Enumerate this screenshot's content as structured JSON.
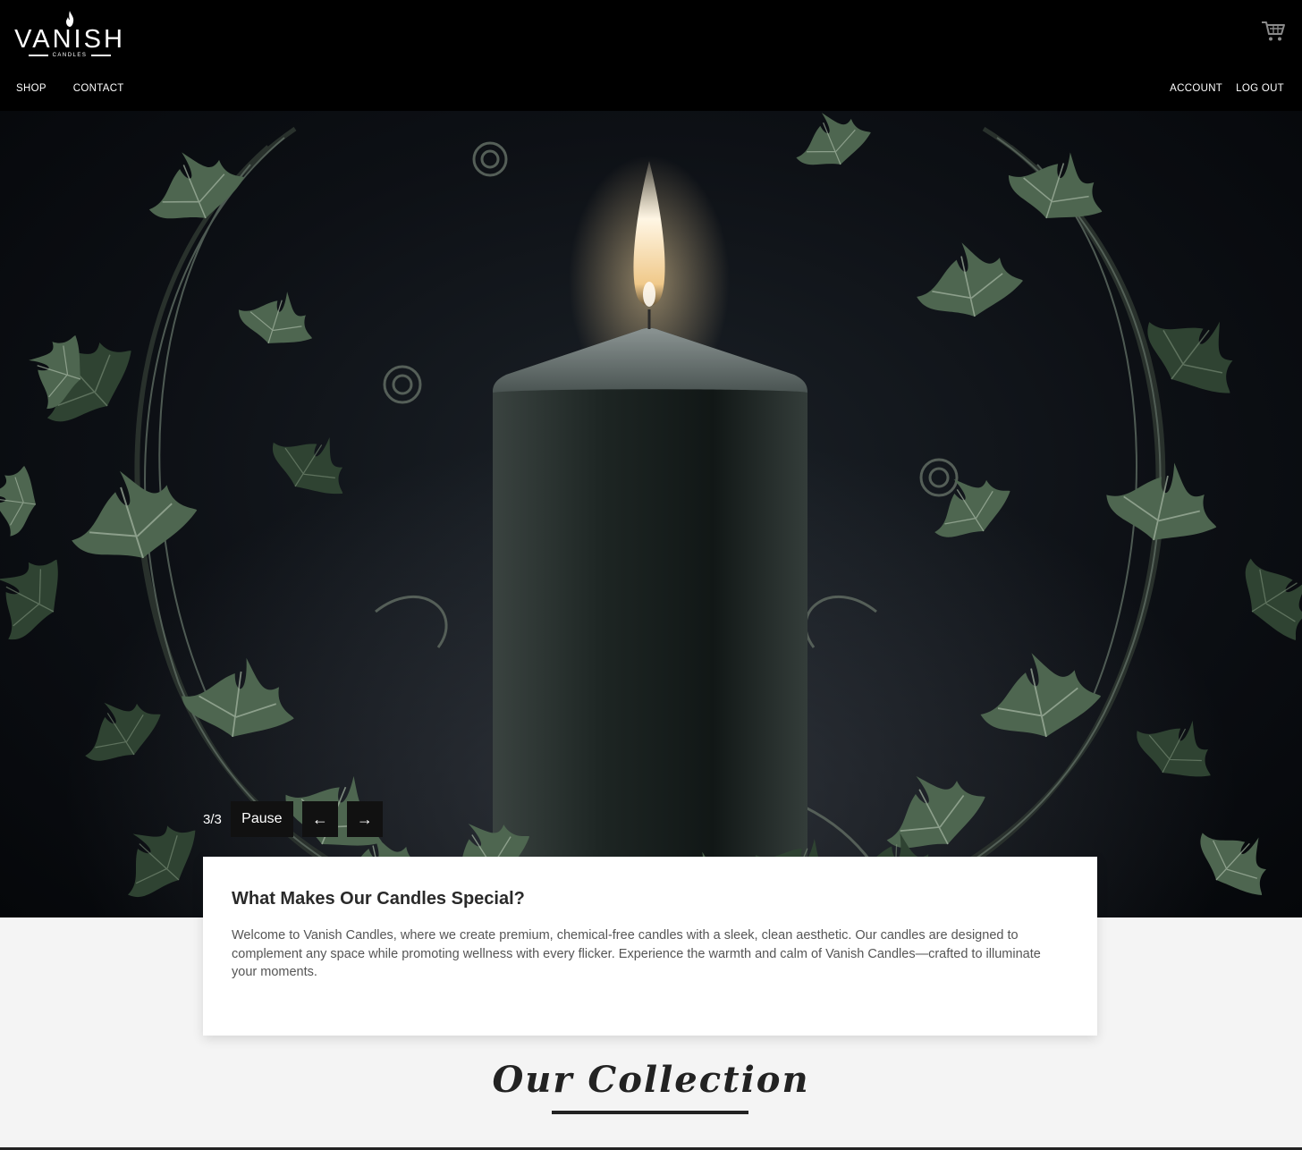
{
  "brand": {
    "name": "VANISH",
    "tagline": "CANDLES"
  },
  "nav": {
    "left": [
      "SHOP",
      "CONTACT"
    ],
    "right": [
      "ACCOUNT",
      "LOG OUT"
    ],
    "cart_icon": "cart-icon"
  },
  "hero": {
    "slide_counter": "3/3",
    "pause_label": "Pause",
    "prev_label": "←",
    "next_label": "→"
  },
  "intro": {
    "heading": "What Makes Our Candles Special?",
    "body": "Welcome to Vanish Candles, where we create premium, chemical-free candles with a sleek, clean aesthetic. Our candles are designed to complement any space while promoting wellness with every flicker. Experience the warmth and calm of Vanish Candles—crafted to illuminate your moments."
  },
  "collection": {
    "title": "Our Collection"
  },
  "colors": {
    "header_bg": "#000000",
    "page_bg": "#f4f4f4",
    "card_bg": "#ffffff",
    "text_dark": "#222222"
  }
}
